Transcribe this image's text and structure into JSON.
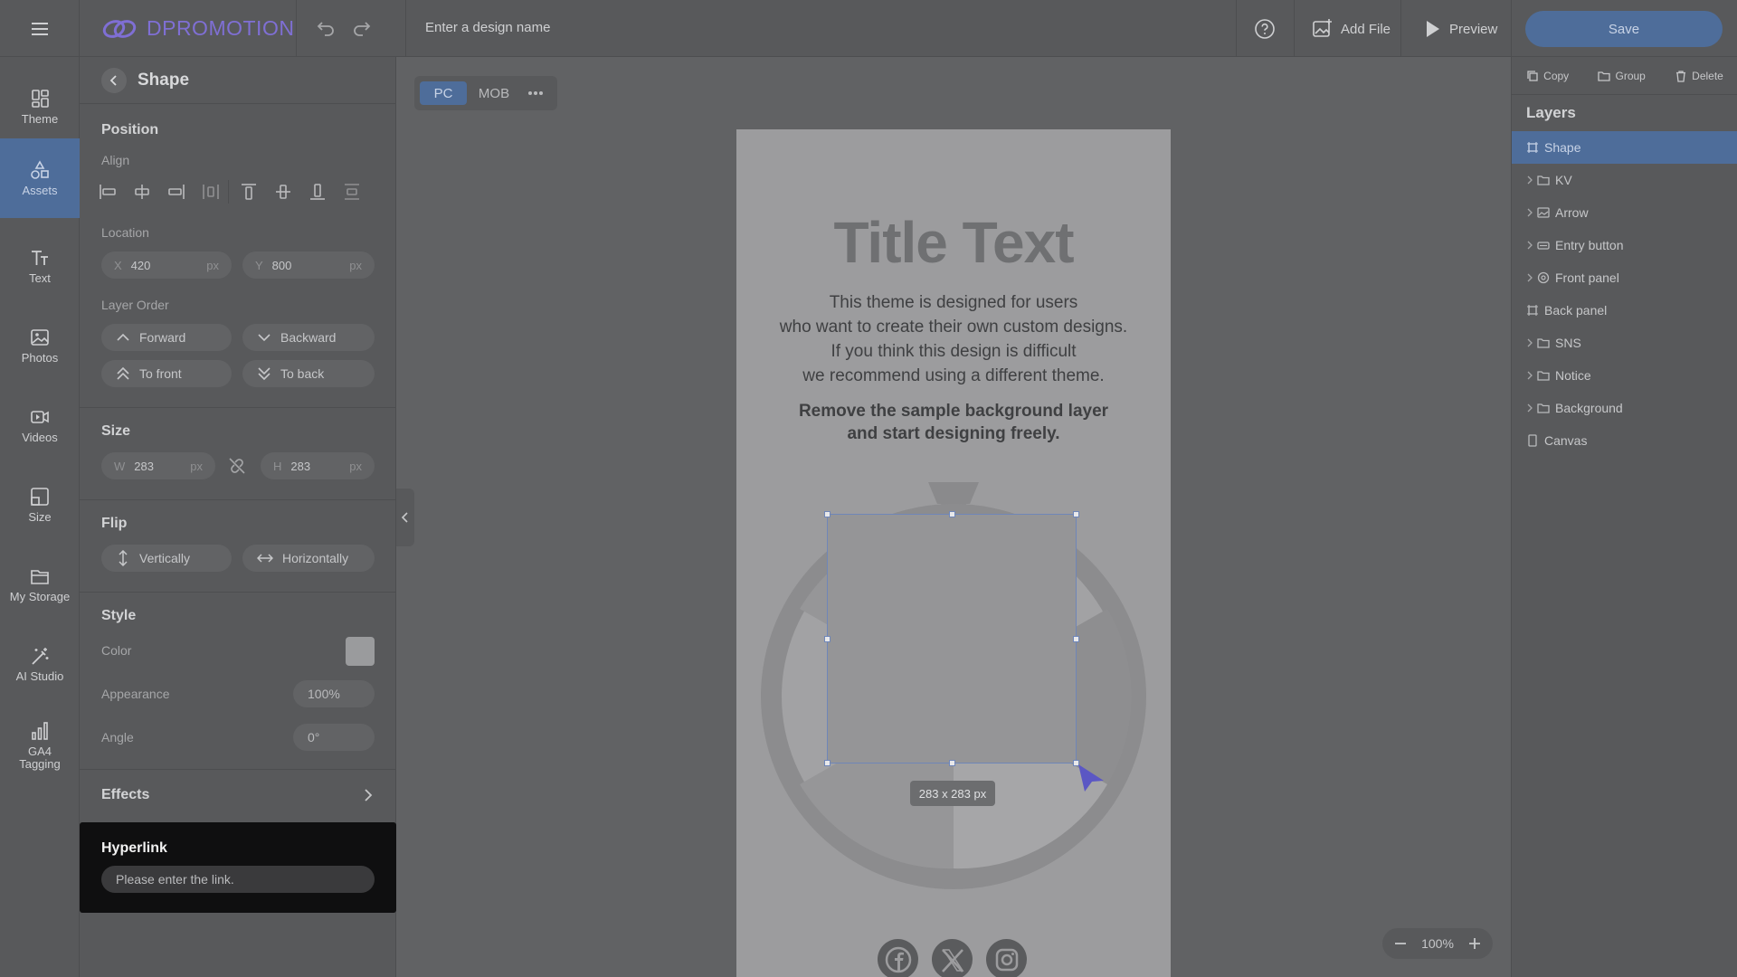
{
  "header": {
    "logo_text": "DPROMOTION",
    "design_name_placeholder": "Enter a design name",
    "add_file_label": "Add File",
    "preview_label": "Preview",
    "save_label": "Save"
  },
  "rail": {
    "items": [
      {
        "label": "Theme",
        "icon": "theme-icon"
      },
      {
        "label": "Assets",
        "icon": "shapes-icon",
        "active": true
      },
      {
        "label": "Text",
        "icon": "text-icon"
      },
      {
        "label": "Photos",
        "icon": "image-icon"
      },
      {
        "label": "Videos",
        "icon": "video-icon"
      },
      {
        "label": "Size",
        "icon": "size-icon"
      },
      {
        "label": "My Storage",
        "icon": "folder-icon"
      },
      {
        "label": "AI Studio",
        "icon": "magic-wand-icon"
      },
      {
        "label": "GA4\nTagging",
        "icon": "bar-chart-icon"
      }
    ]
  },
  "props": {
    "title": "Shape",
    "position_title": "Position",
    "align_label": "Align",
    "location_label": "Location",
    "x_prefix": "X",
    "x_value": "420",
    "y_prefix": "Y",
    "y_value": "800",
    "unit": "px",
    "layer_order_label": "Layer Order",
    "forward": "Forward",
    "backward": "Backward",
    "to_front": "To front",
    "to_back": "To back",
    "size_title": "Size",
    "w_prefix": "W",
    "w_value": "283",
    "h_prefix": "H",
    "h_value": "283",
    "flip_title": "Flip",
    "vertically": "Vertically",
    "horizontally": "Horizontally",
    "style_title": "Style",
    "color_label": "Color",
    "color_value": "#9a9b9d",
    "appearance_label": "Appearance",
    "appearance_value": "100%",
    "angle_label": "Angle",
    "angle_value": "0°",
    "effects_title": "Effects",
    "hyperlink_title": "Hyperlink",
    "hyperlink_placeholder": "Please enter the link."
  },
  "canvas": {
    "device_pc": "PC",
    "device_mob": "MOB",
    "title_text": "Title Text",
    "body_lines": [
      "This theme is designed for users",
      "who want to create their own custom designs.",
      "If you think this design is difficult",
      "we recommend using a different theme."
    ],
    "bold_lines": [
      "Remove the sample background layer",
      "and start designing freely."
    ],
    "size_tag": "283 x 283 px",
    "zoom_value": "100%"
  },
  "layers": {
    "copy_label": "Copy",
    "group_label": "Group",
    "delete_label": "Delete",
    "title": "Layers",
    "items": [
      {
        "label": "Shape",
        "icon": "shape-icon",
        "expandable": false,
        "selected": true
      },
      {
        "label": "KV",
        "icon": "folder-icon",
        "expandable": true
      },
      {
        "label": "Arrow",
        "icon": "image-icon",
        "expandable": true
      },
      {
        "label": "Entry button",
        "icon": "button-icon",
        "expandable": true
      },
      {
        "label": "Front panel",
        "icon": "aperture-icon",
        "expandable": true
      },
      {
        "label": "Back panel",
        "icon": "shape-icon",
        "expandable": false
      },
      {
        "label": "SNS",
        "icon": "folder-icon",
        "expandable": true
      },
      {
        "label": "Notice",
        "icon": "folder-icon",
        "expandable": true
      },
      {
        "label": "Background",
        "icon": "folder-icon",
        "expandable": true
      },
      {
        "label": "Canvas",
        "icon": "page-icon",
        "expandable": false
      }
    ]
  },
  "colors": {
    "accent": "#4e6d9a",
    "logo": "#7f6fd4",
    "cursor": "#5b57c4"
  }
}
